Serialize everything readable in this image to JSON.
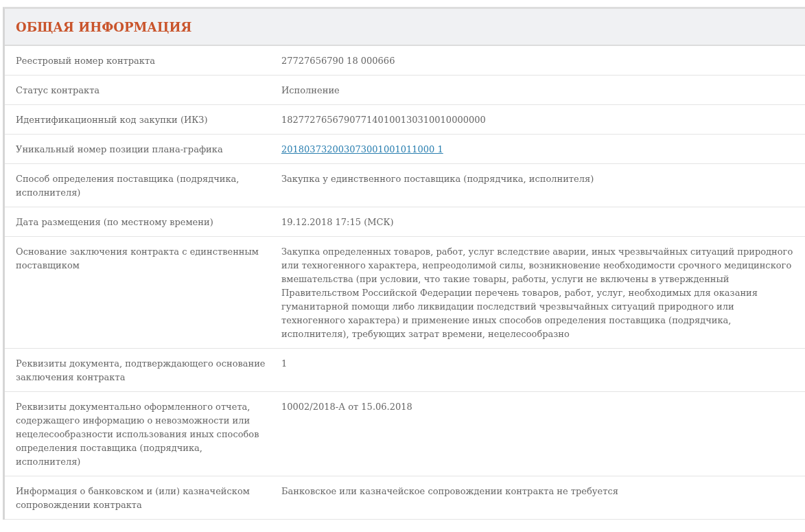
{
  "section": {
    "title": "ОБЩАЯ ИНФОРМАЦИЯ"
  },
  "rows": [
    {
      "label": "Реестровый номер контракта",
      "value": "27727656790 18 000666",
      "kind": "text"
    },
    {
      "label": "Статус контракта",
      "value": "Исполнение",
      "kind": "text"
    },
    {
      "label": "Идентификационный код закупки (ИКЗ)",
      "value": "182772765679077140100130310010000000",
      "kind": "text"
    },
    {
      "label": "Уникальный номер позиции плана-графика",
      "value": "201803732003073001001011000 1",
      "kind": "link"
    },
    {
      "label": "Способ определения поставщика (подрядчика, исполнителя)",
      "value": "Закупка у единственного поставщика (подрядчика, исполнителя)",
      "kind": "text"
    },
    {
      "label": "Дата размещения (по местному времени)",
      "value": "19.12.2018 17:15 (МСК)",
      "kind": "text"
    },
    {
      "label": "Основание заключения контракта с единственным поставщиком",
      "value": "Закупка определенных товаров, работ, услуг вследствие аварии, иных чрезвычайных ситуаций природного или техногенного характера, непреодолимой силы, возникновение необходимости срочного медицинского вмешательства (при условии, что такие товары, работы, услуги не включены в утвержденный Правительством Российской Федерации перечень товаров, работ, услуг, необходимых для оказания гуманитарной помощи либо ликвидации последствий чрезвычайных ситуаций природного или техногенного характера) и применение иных способов определения поставщика (подрядчика, исполнителя), требующих затрат времени, нецелесообразно",
      "kind": "text"
    },
    {
      "label": "Реквизиты документа, подтверждающего основание заключения контракта",
      "value": "1",
      "kind": "text"
    },
    {
      "label": "Реквизиты документально оформленного отчета, содержащего информацию о невозможности или нецелесообразности использования иных способов определения поставщика (подрядчика, исполнителя)",
      "value": "10002/2018-А от 15.06.2018",
      "kind": "text"
    },
    {
      "label": "Информация о банковском и (или) казначейском сопровождении контракта",
      "value": "Банковское или казначейское сопровождении контракта не требуется",
      "kind": "text"
    }
  ]
}
